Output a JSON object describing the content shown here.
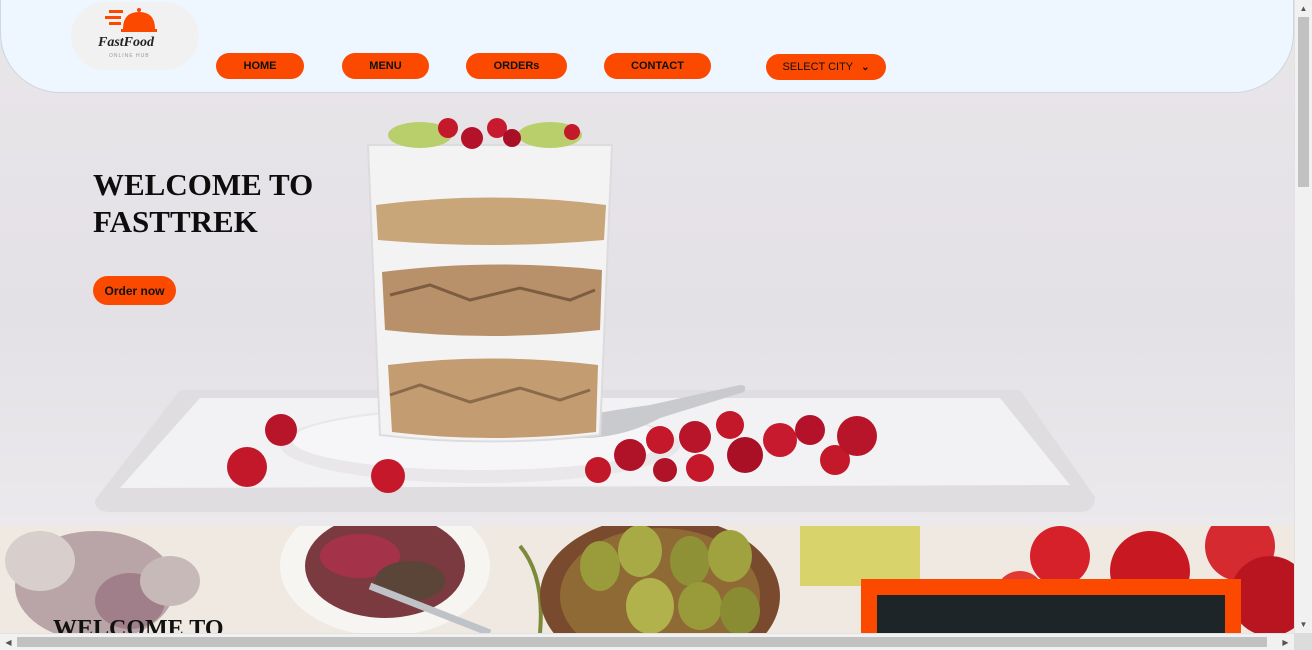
{
  "header": {
    "logo": {
      "title": "FastFood",
      "subtitle": "ONLINE HUB"
    },
    "nav": [
      {
        "label": "HOME"
      },
      {
        "label": "MENU"
      },
      {
        "label": "ORDERs"
      },
      {
        "label": "CONTACT"
      }
    ],
    "city_select": {
      "selected": "SELECT CITY",
      "icon": "chevron-down-icon"
    }
  },
  "hero": {
    "title_line1": "WELCOME TO",
    "title_line2": "FASTTREK",
    "cta_label": "Order now"
  },
  "section2": {
    "title": "WELCOME TO"
  },
  "colors": {
    "accent": "#fb4900",
    "header_bg": "#eef7ff",
    "text": "#0d0d0d"
  },
  "scrollbars": {
    "icons": [
      "arrow-up-icon",
      "arrow-down-icon",
      "arrow-left-icon",
      "arrow-right-icon"
    ]
  }
}
